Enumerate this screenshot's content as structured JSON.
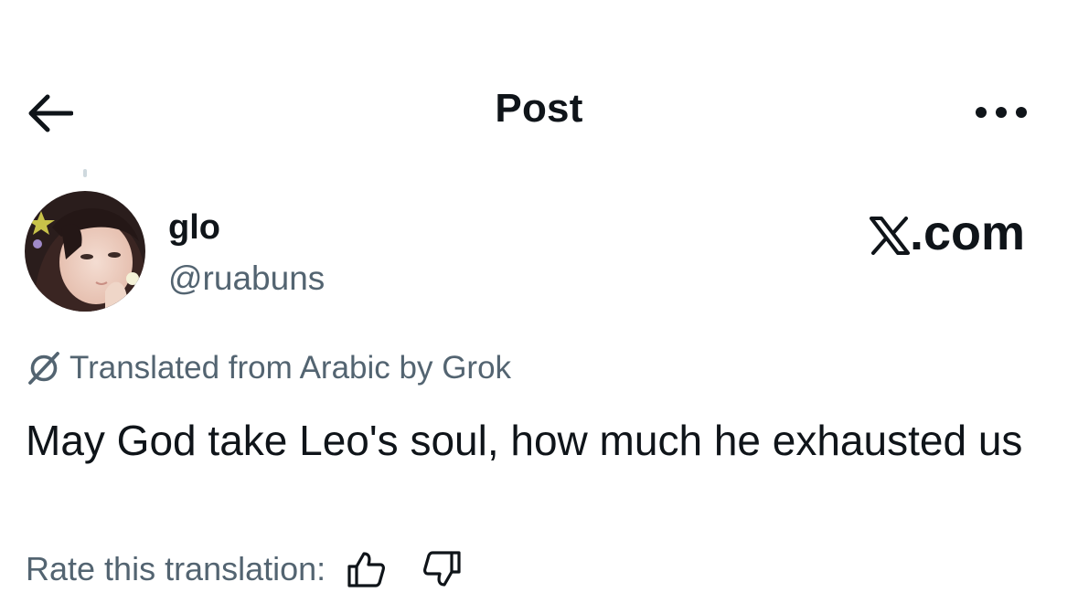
{
  "header": {
    "title": "Post",
    "back_icon": "arrow-left-icon",
    "more_icon": "more-horizontal-icon"
  },
  "author": {
    "name": "glo",
    "handle": "@ruabuns",
    "avatar_icon": "avatar-photo"
  },
  "watermark": {
    "text": ".com",
    "logo": "x-logo"
  },
  "translation": {
    "label": "Translated from Arabic by Grok",
    "icon": "grok-icon"
  },
  "post": {
    "text": "May God take Leo's soul, how much he exhausted us"
  },
  "rating": {
    "label": "Rate this translation:",
    "like_icon": "thumbs-up-icon",
    "dislike_icon": "thumbs-down-icon"
  },
  "colors": {
    "primary_text": "#0f1419",
    "secondary_text": "#536471",
    "background": "#ffffff"
  }
}
